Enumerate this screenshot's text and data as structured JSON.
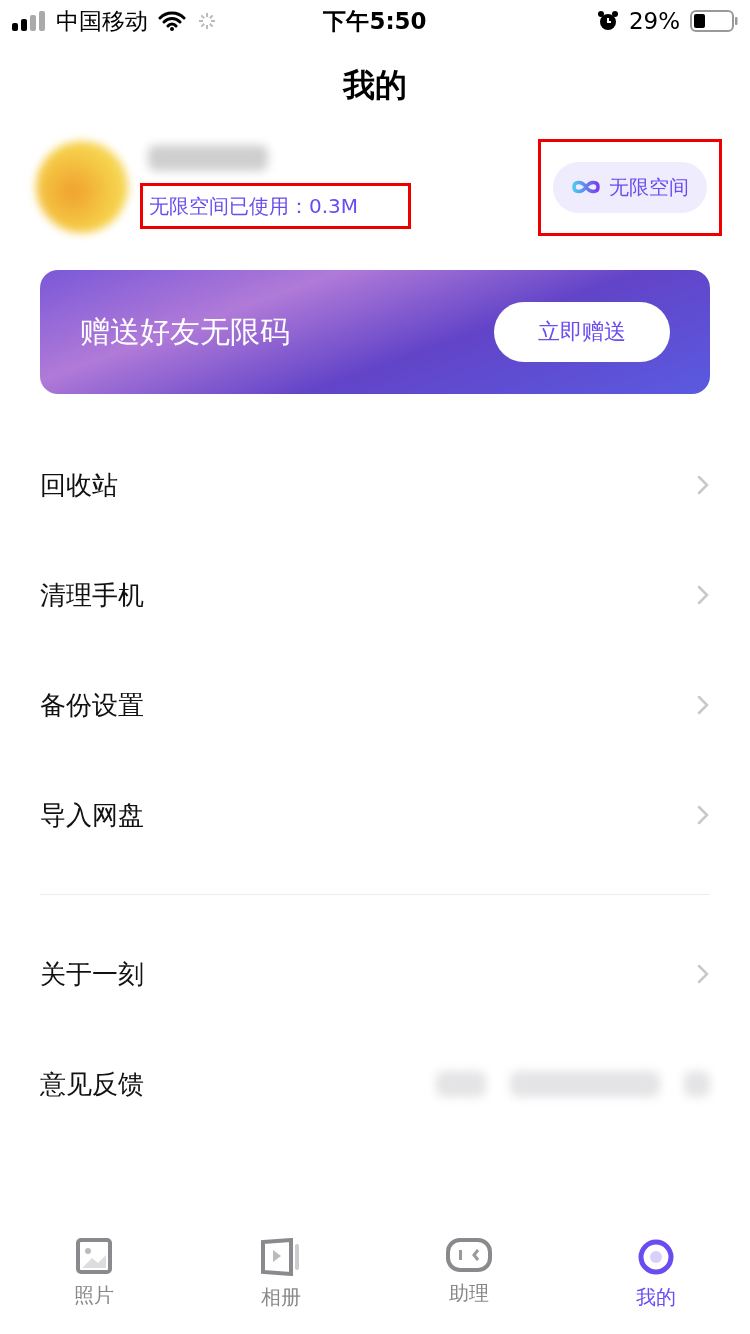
{
  "status_bar": {
    "carrier": "中国移动",
    "time": "下午5:50",
    "battery": "29%"
  },
  "title": "我的",
  "profile": {
    "usage": "无限空间已使用：0.3M",
    "usage_highlighted": true,
    "space_button": "无限空间",
    "space_button_highlighted": true
  },
  "banner": {
    "text": "赠送好友无限码",
    "button": "立即赠送"
  },
  "menu_groups": [
    [
      {
        "label": "回收站",
        "kind": "link"
      },
      {
        "label": "清理手机",
        "kind": "link"
      },
      {
        "label": "备份设置",
        "kind": "link"
      },
      {
        "label": "导入网盘",
        "kind": "link"
      }
    ],
    [
      {
        "label": "关于一刻",
        "kind": "link"
      },
      {
        "label": "意见反馈",
        "kind": "redacted"
      }
    ]
  ],
  "tabs": [
    {
      "label": "照片",
      "selected": false
    },
    {
      "label": "相册",
      "selected": false
    },
    {
      "label": "助理",
      "selected": false
    },
    {
      "label": "我的",
      "selected": true
    }
  ]
}
